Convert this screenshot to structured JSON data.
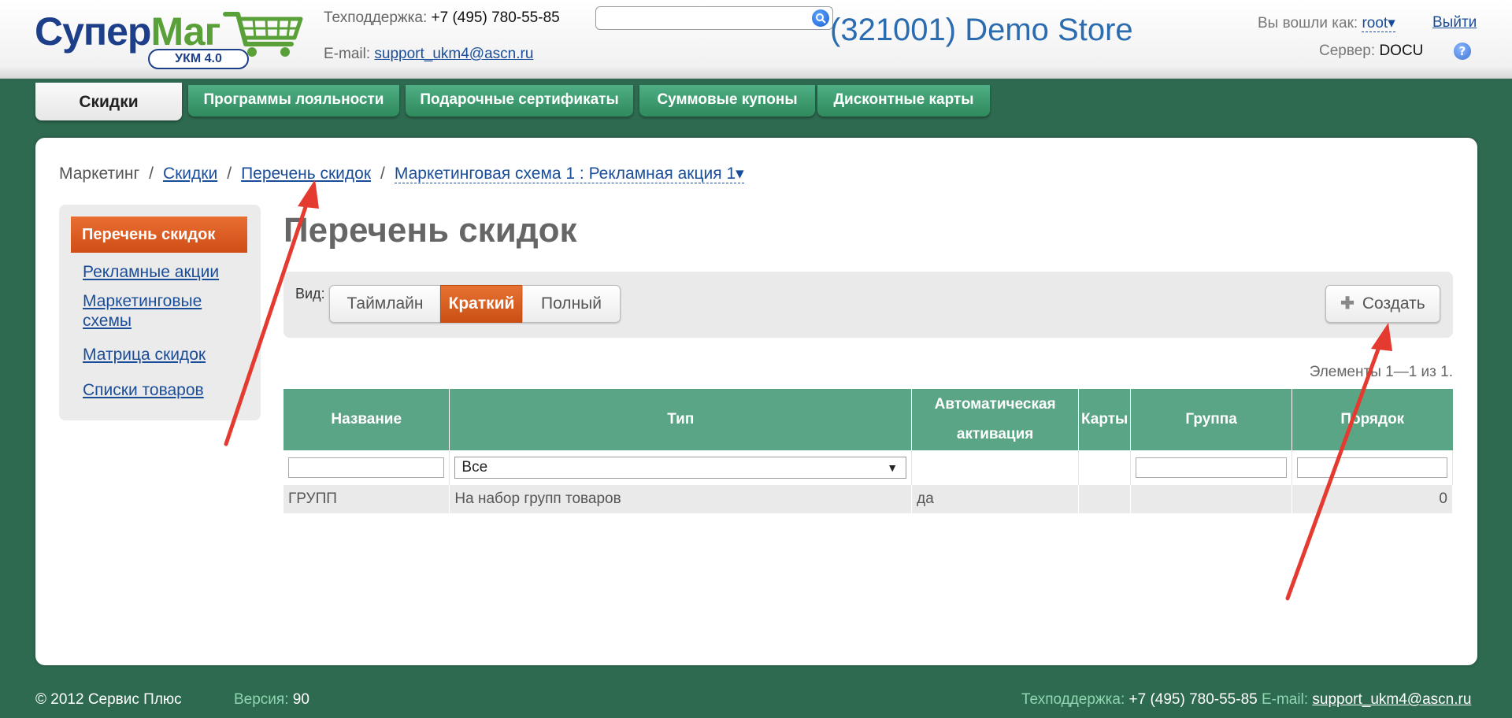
{
  "logo": {
    "part1": "Супер",
    "part2": "Маг",
    "badge": "УКМ 4.0"
  },
  "header": {
    "support_label": "Техподдержка:",
    "support_phone": "+7 (495) 780-55-85",
    "email_label": "E-mail:",
    "email": "support_ukm4@ascn.ru",
    "search_placeholder": "",
    "store_title": "(321001) Demo Store",
    "logged_label": "Вы вошли как:",
    "user": "root▾",
    "logout": "Выйти",
    "server_label": "Сервер:",
    "server": "DOCU",
    "help": "?"
  },
  "tabs": [
    {
      "label": "Скидки",
      "active": true
    },
    {
      "label": "Программы лояльности"
    },
    {
      "label": "Подарочные сертификаты"
    },
    {
      "label": "Суммовые купоны"
    },
    {
      "label": "Дисконтные карты"
    }
  ],
  "breadcrumb": {
    "root": "Маркетинг",
    "sep": "/",
    "items": [
      "Скидки",
      "Перечень скидок",
      "Маркетинговая схема 1 : Рекламная акция 1▾"
    ]
  },
  "sidebar": {
    "active": "Перечень скидок",
    "items": [
      "Рекламные акции",
      "Маркетинговые схемы",
      "Матрица скидок",
      "Списки товаров"
    ]
  },
  "page": {
    "title": "Перечень скидок"
  },
  "toolbar": {
    "view_label": "Вид:",
    "views": [
      "Таймлайн",
      "Краткий",
      "Полный"
    ],
    "selected_view": "Краткий",
    "create_icon": "plus-icon",
    "create_label": "Создать"
  },
  "count": "Элементы 1—1 из 1.",
  "table": {
    "headers": [
      "Название",
      "Тип",
      "Автоматическая активация",
      "Карты",
      "Группа",
      "Порядок"
    ],
    "type_filter": "Все",
    "rows": [
      [
        "ГРУПП",
        "На набор групп товаров",
        "да",
        "",
        "",
        "0"
      ]
    ]
  },
  "footer": {
    "copyright": "© 2012 Сервис Плюс",
    "version_label": "Версия:",
    "version": "90",
    "support_label": "Техподдержка:",
    "support_phone": "+7 (495) 780-55-85",
    "email_label": "E-mail:",
    "email": "support_ukm4@ascn.ru"
  },
  "colors": {
    "accent_green": "#2e6a50",
    "tab_green": "#3f9a6f",
    "orange": "#d9561b",
    "link": "#1a4d99",
    "annotation_red": "#e53a2f"
  }
}
